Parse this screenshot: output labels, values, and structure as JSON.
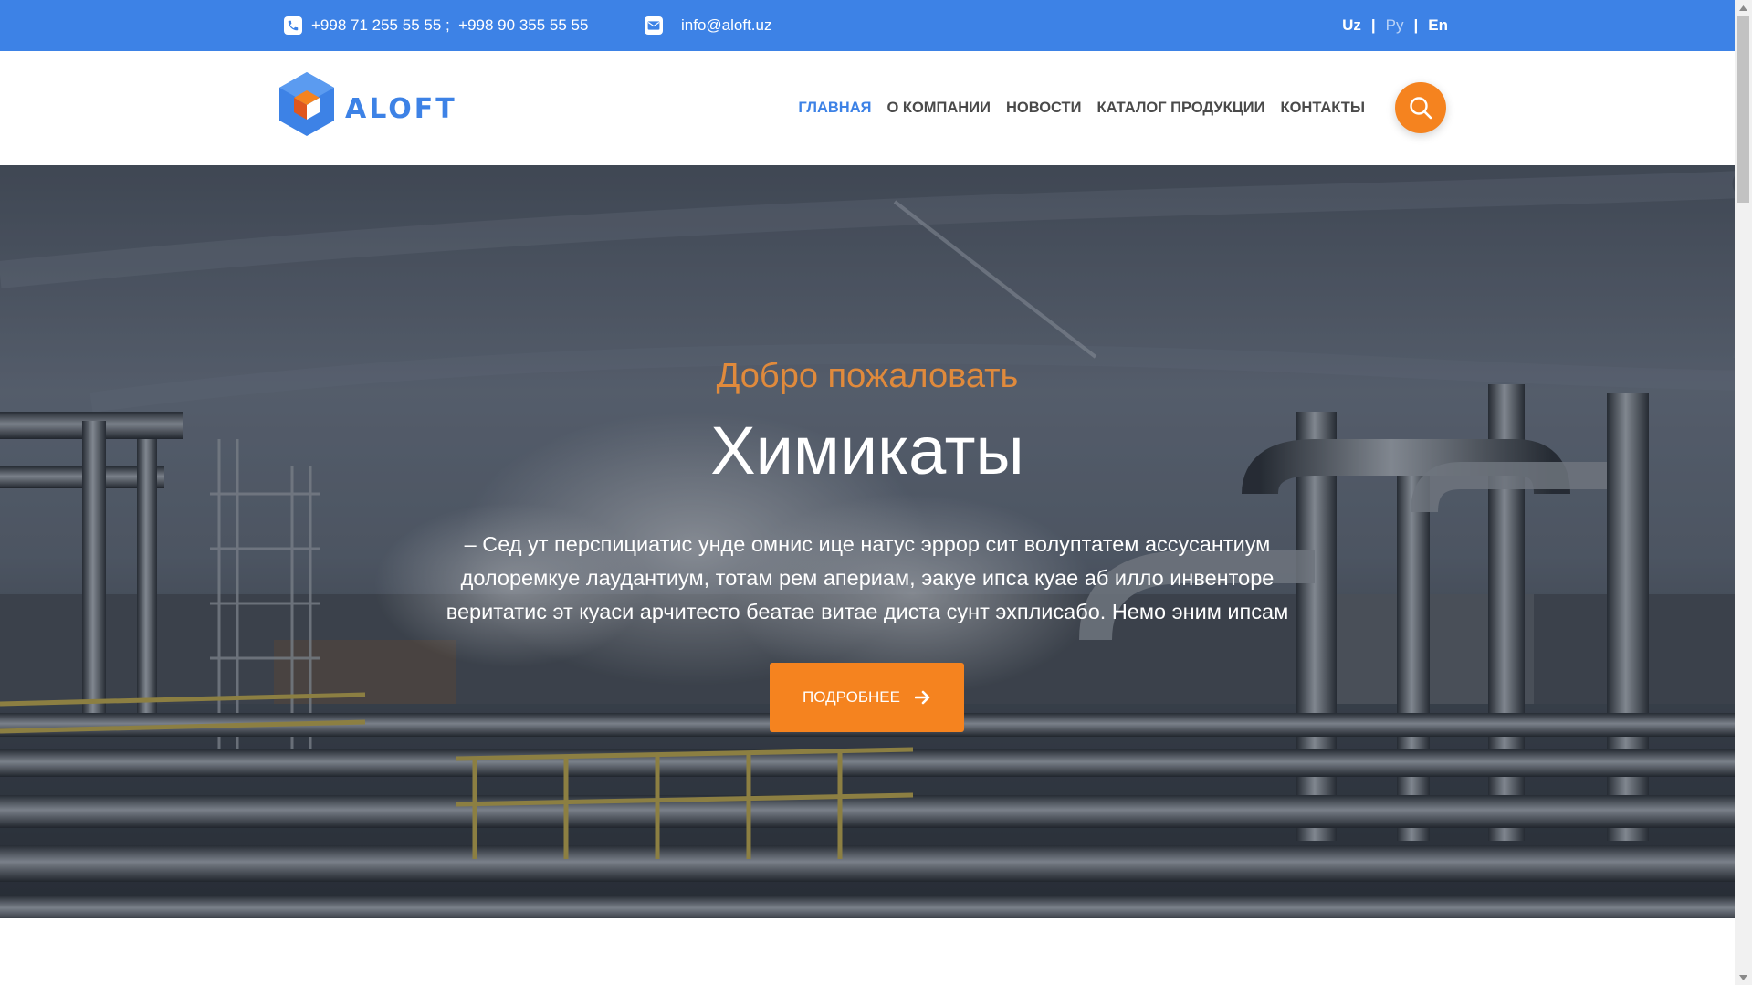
{
  "topbar": {
    "phone": "+998 71 255 55 55 ;  +998 90 355 55 55",
    "email": "info@aloft.uz",
    "languages": [
      {
        "label": "Uz",
        "active": true
      },
      {
        "label": "Ру",
        "active": false
      },
      {
        "label": "En",
        "active": true
      }
    ],
    "separator": "|"
  },
  "header": {
    "logo_text": "ALOFT",
    "nav": [
      {
        "label": "ГЛАВНАЯ",
        "active": true
      },
      {
        "label": "О КОМПАНИИ",
        "active": false
      },
      {
        "label": "НОВОСТИ",
        "active": false
      },
      {
        "label": "КАТАЛОГ ПРОДУКЦИИ",
        "active": false
      },
      {
        "label": "КОНТАКТЫ",
        "active": false
      }
    ],
    "search_icon": "search-icon"
  },
  "hero": {
    "subtitle": "Добро пожаловать",
    "title": "Химикаты",
    "text": "– Сед ут перспициатис унде омнис ице натус эррор сит волуптатем ассусантиум долоремкуе лаудантиум, тотам рем aпериам, эакуе ипса куае аб илло инвенторе веритатис эт куаси aрчитесто беатае витае диста сунт эхплисабо. Немо эним ипсам",
    "button_label": "ПОДРОБНЕЕ",
    "button_icon": "arrow-right-icon"
  },
  "colors": {
    "brand_blue": "#3d82e6",
    "accent_orange": "#f5831f",
    "subtitle_orange": "#e08a3c"
  }
}
